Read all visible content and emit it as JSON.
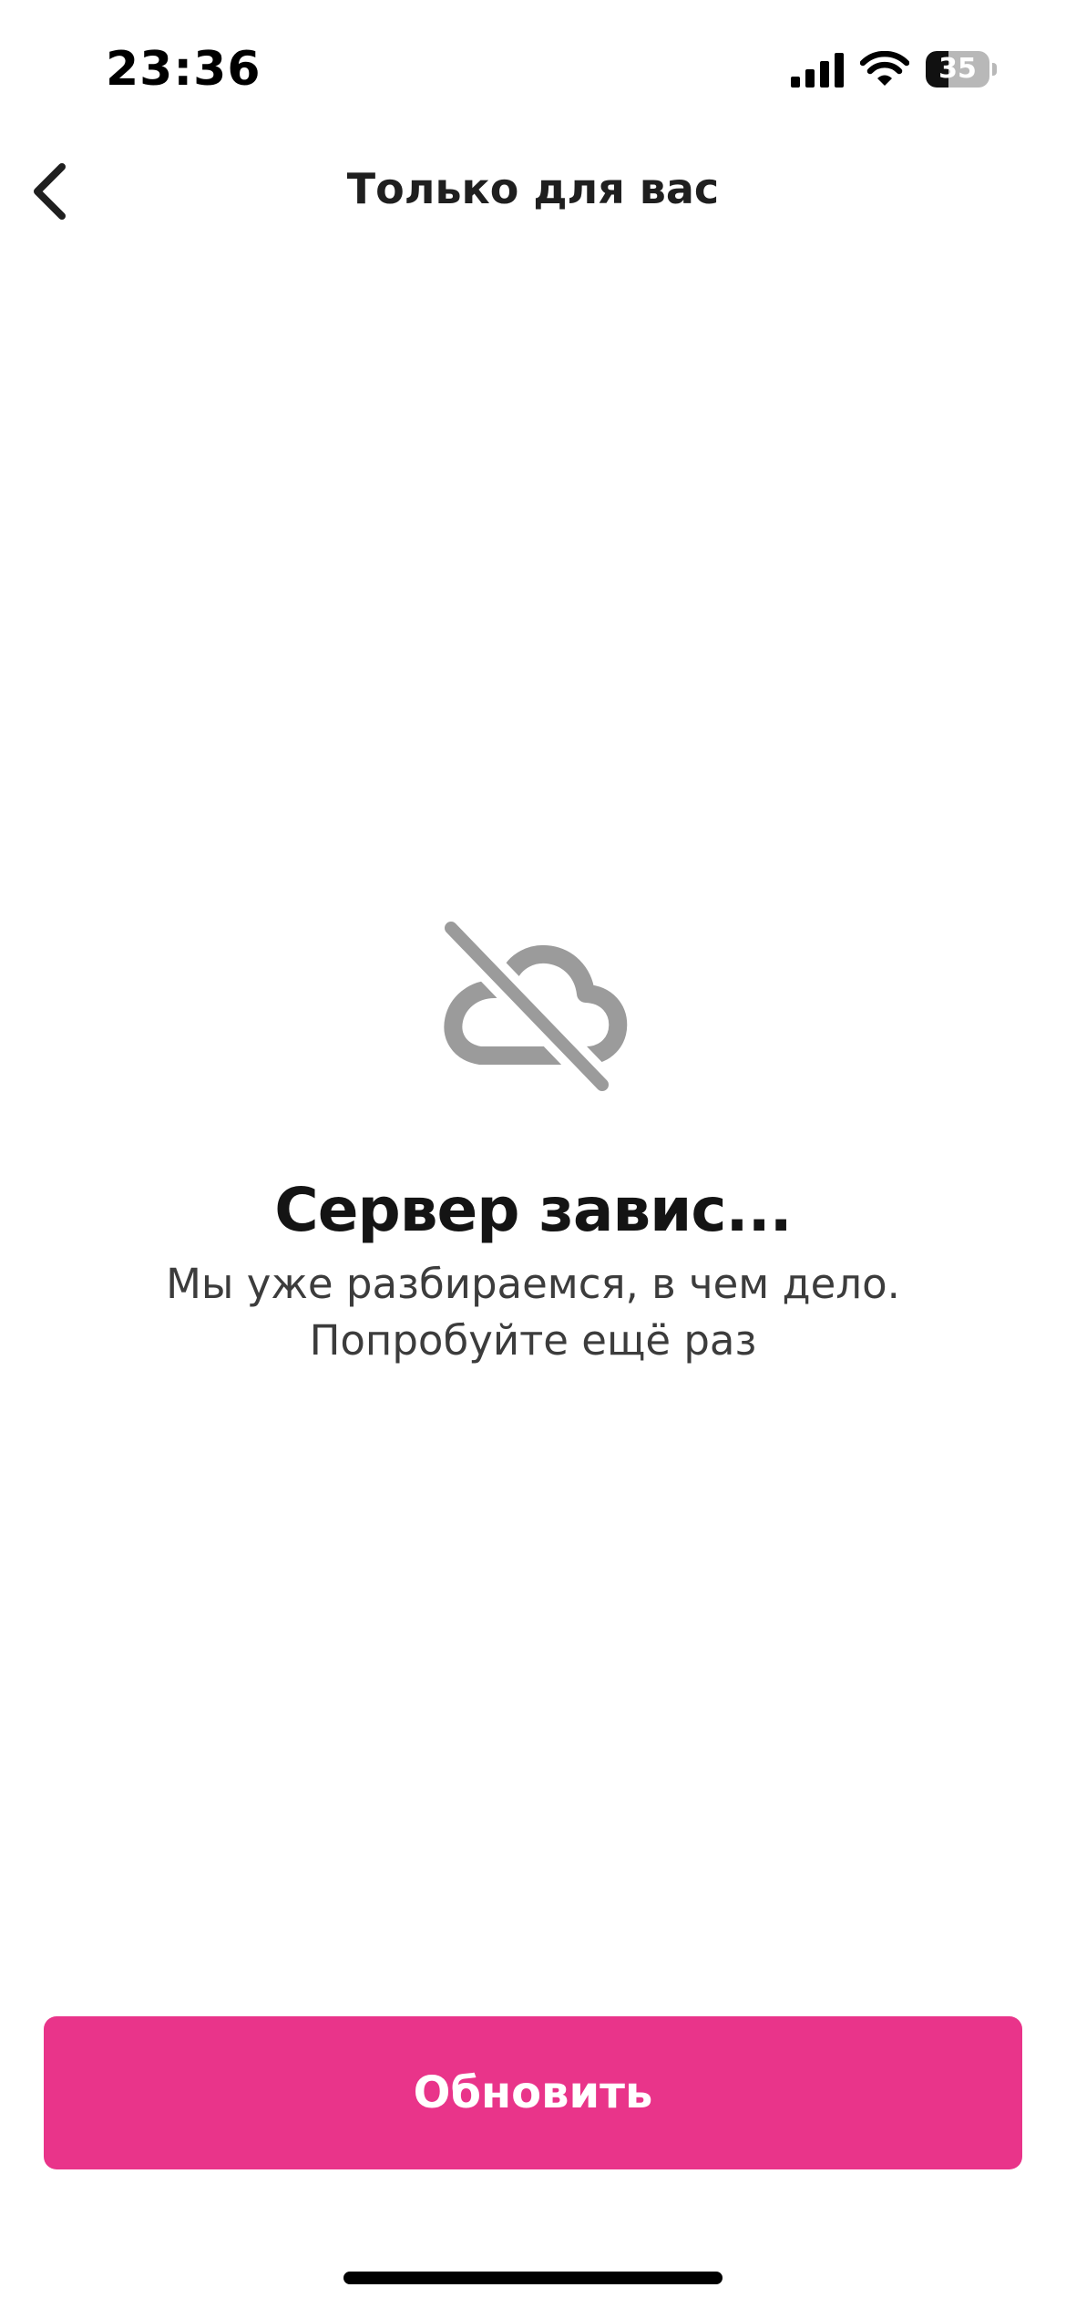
{
  "status_bar": {
    "time": "23:36",
    "battery_level": "35",
    "battery_fraction": 0.35,
    "icons": [
      "cellular-signal-icon",
      "wifi-icon",
      "battery-icon"
    ]
  },
  "nav": {
    "back_icon": "chevron-left-icon",
    "title": "Только для вас"
  },
  "error": {
    "icon": "cloud-off-icon",
    "title": "Сервер завис...",
    "message": "Мы уже разбираемся, в чем дело.\nПопробуйте ещё раз"
  },
  "actions": {
    "refresh_label": "Обновить"
  },
  "colors": {
    "accent": "#e9348a",
    "icon_gray": "#9b9b9b",
    "text_primary": "#141414",
    "text_secondary": "#3c3c3c"
  }
}
